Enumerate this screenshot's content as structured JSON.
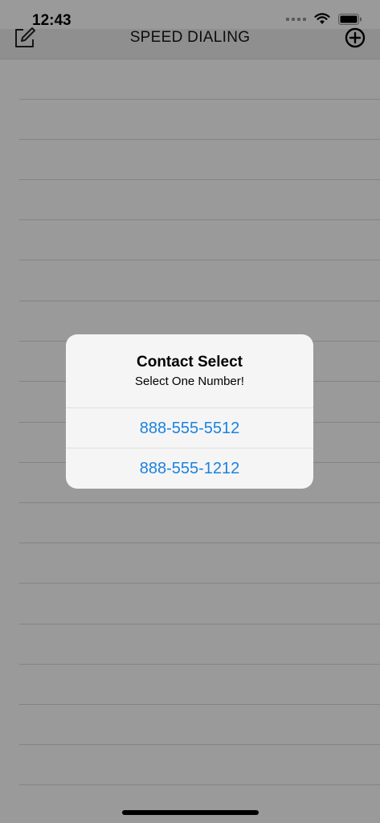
{
  "status": {
    "time": "12:43"
  },
  "nav": {
    "title": "SPEED DIALING"
  },
  "dialog": {
    "title": "Contact Select",
    "message": "Select One Number!",
    "options": [
      "888-555-5512",
      "888-555-1212"
    ]
  },
  "icons": {
    "edit": "edit-icon",
    "add": "add-circle-icon",
    "wifi": "wifi-icon",
    "battery": "battery-icon"
  },
  "colors": {
    "accent": "#1a82e0"
  }
}
